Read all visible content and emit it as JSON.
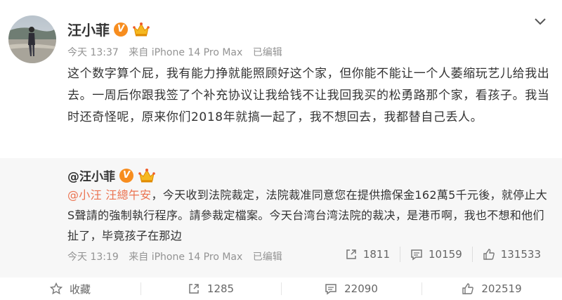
{
  "post": {
    "author": "汪小菲",
    "verified_badge": "V",
    "time": "今天 13:37",
    "source": "来自 iPhone 14 Pro Max",
    "edited": "已编辑",
    "content": "这个数字算个屁，我有能力挣就能照顾好这个家，但你能不能让一个人萎缩玩艺儿给我出去。一周后你跟我签了个补充协议让我给钱不让我回我买的松勇路那个家，看孩子。我当时还奇怪呢，原来你们2018年就搞一起了，我不想回去，我都替自己丢人。"
  },
  "repost": {
    "author": "@汪小菲",
    "mentions": "@小汪 汪總午安",
    "text": "，今天收到法院裁定，法院裁准同意您在提供擔保金162萬5千元後，就停止大S聲請的強制執行程序。請參裁定檔案。今天台湾台湾法院的裁决，是港币啊，我也不想和他们扯了，毕竟孩子在那边",
    "time": "今天 13:19",
    "source": "来自 iPhone 14 Pro Max",
    "edited": "已编辑",
    "stats": {
      "reposts": "1811",
      "comments": "10159",
      "likes": "131533"
    }
  },
  "actions": {
    "favorite": "收藏",
    "repost": "1285",
    "comment": "22090",
    "like": "202519"
  },
  "colors": {
    "mention": "#eb7350",
    "meta": "#939393",
    "repost_bg": "#f7f7f7",
    "v_badge": "#f78d1f"
  }
}
